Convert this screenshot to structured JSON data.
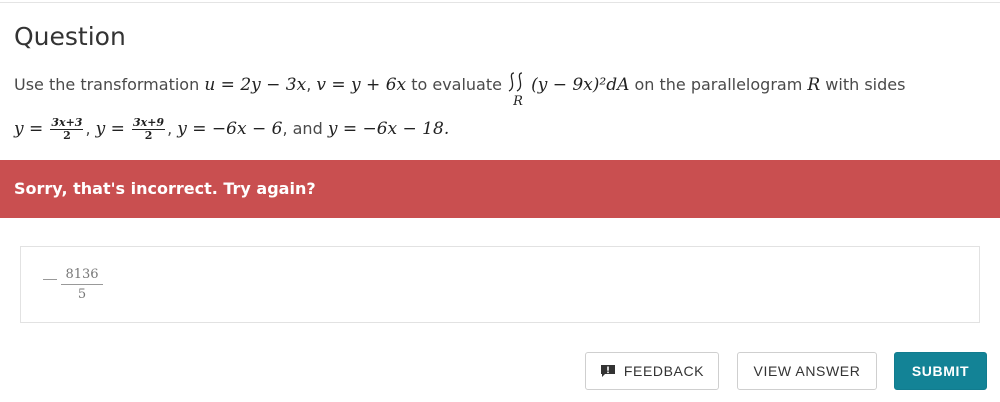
{
  "section": {
    "title": "Question"
  },
  "question": {
    "intro": "Use the transformation",
    "u_eq": "u = 2y − 3x",
    "sep1": ",",
    "v_eq": "v = y + 6x",
    "to_evaluate": "to evaluate",
    "integrand": "(y − 9x)²dA",
    "region_sub": "R",
    "on_text": "on the parallelogram",
    "region": "R",
    "with_sides": "with sides",
    "side1_lhs": "y =",
    "side1_num": "3x+3",
    "side1_den": "2",
    "sep2": ",",
    "side2_lhs": "y =",
    "side2_num": "3x+9",
    "side2_den": "2",
    "sep3": ",",
    "side3": "y = −6x − 6",
    "sep4": ", and",
    "side4": "y = −6x − 18."
  },
  "feedback_banner": {
    "message": "Sorry, that's incorrect. Try again?",
    "color": "#c94f50"
  },
  "answer": {
    "numerator": "8136",
    "denominator": "5",
    "sign": "−"
  },
  "buttons": {
    "feedback": "FEEDBACK",
    "view_answer": "VIEW ANSWER",
    "submit": "SUBMIT",
    "submit_color": "#138396"
  }
}
